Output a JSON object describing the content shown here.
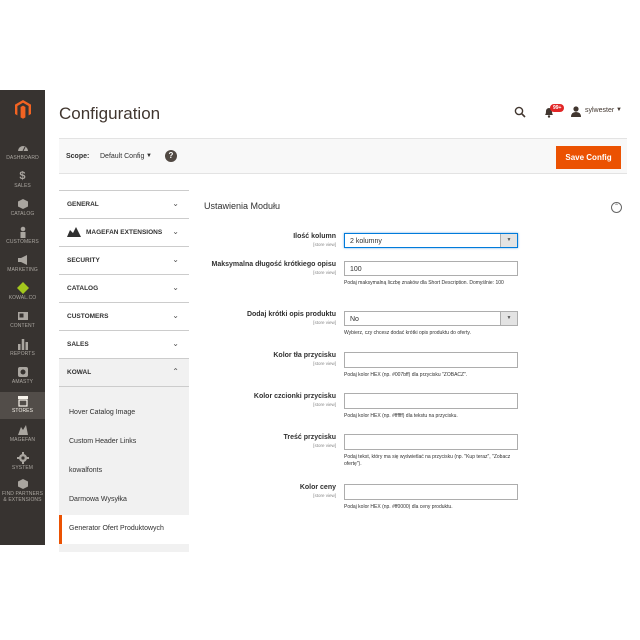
{
  "sidebar": {
    "items": [
      {
        "label": "DASHBOARD",
        "icon": "dashboard-icon"
      },
      {
        "label": "SALES",
        "icon": "dollar-icon"
      },
      {
        "label": "CATALOG",
        "icon": "cube-icon"
      },
      {
        "label": "CUSTOMERS",
        "icon": "customer-icon"
      },
      {
        "label": "MARKETING",
        "icon": "megaphone-icon"
      },
      {
        "label": "KOWAL.CO",
        "icon": "kowal-diamond-icon"
      },
      {
        "label": "CONTENT",
        "icon": "content-icon"
      },
      {
        "label": "REPORTS",
        "icon": "bar-chart-icon"
      },
      {
        "label": "AMASTY",
        "icon": "amasty-icon"
      },
      {
        "label": "STORES",
        "icon": "store-icon"
      },
      {
        "label": "MAGEFAN",
        "icon": "magefan-icon"
      },
      {
        "label": "SYSTEM",
        "icon": "gear-icon"
      },
      {
        "label": "FIND PARTNERS & EXTENSIONS",
        "icon": "partners-icon"
      }
    ]
  },
  "header": {
    "title": "Configuration",
    "notifications_badge": "99+",
    "user": "sylwester"
  },
  "scope": {
    "label": "Scope:",
    "value": "Default Config",
    "help": "?",
    "save_label": "Save Config"
  },
  "tabs": [
    {
      "label": "GENERAL"
    },
    {
      "label": "MAGEFAN EXTENSIONS"
    },
    {
      "label": "SECURITY"
    },
    {
      "label": "CATALOG"
    },
    {
      "label": "CUSTOMERS"
    },
    {
      "label": "SALES"
    },
    {
      "label": "KOWAL"
    }
  ],
  "kowal_subitems": [
    "Hover Catalog Image",
    "Custom Header Links",
    "kowalfonts",
    "Darmowa Wysyłka",
    "Generator Ofert Produktowych"
  ],
  "section": {
    "title": "Ustawienia Modułu",
    "fields": [
      {
        "label": "Ilość kolumn",
        "scope": "[store view]",
        "value": "2 kolumny",
        "note": ""
      },
      {
        "label": "Maksymalna długość krótkiego opisu",
        "scope": "[store view]",
        "value": "100",
        "note": "Podaj maksymalną liczbę znaków dla Short Description. Domyślnie: 100"
      },
      {
        "label": "Dodaj krótki opis produktu",
        "scope": "[store view]",
        "value": "No",
        "note": "Wybierz, czy chcesz dodać krótki opis produktu do oferty."
      },
      {
        "label": "Kolor tła przycisku",
        "scope": "[store view]",
        "value": "",
        "note": "Podaj kolor HEX (np. #007bff) dla przycisku \"ZOBACZ\"."
      },
      {
        "label": "Kolor czcionki przycisku",
        "scope": "[store view]",
        "value": "",
        "note": "Podaj kolor HEX (np. #ffffff) dla tekstu na przycisku."
      },
      {
        "label": "Treść przycisku",
        "scope": "[store view]",
        "value": "",
        "note": "Podaj tekst, który ma się wyświetlać na przycisku (np. \"Kup teraz\", \"Zobacz ofertę\")."
      },
      {
        "label": "Kolor ceny",
        "scope": "[store view]",
        "value": "",
        "note": "Podaj kolor HEX (np. #ff0000) dla ceny produktu."
      }
    ]
  },
  "colors": {
    "accent": "#eb5202",
    "sidebar": "#373330"
  }
}
